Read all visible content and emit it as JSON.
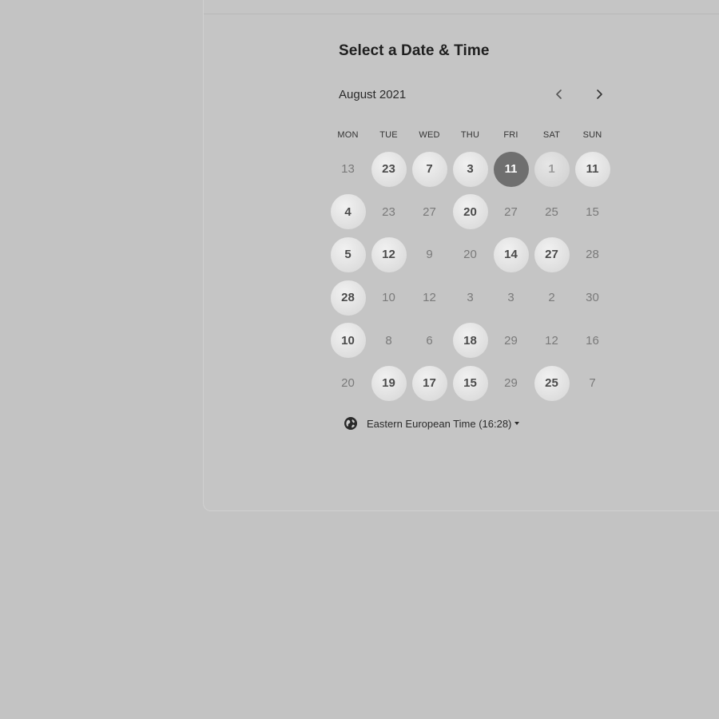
{
  "page": {
    "title": "Select a Date & Time"
  },
  "calendar": {
    "month_label": "August 2021",
    "prev_icon": "chevron-left-icon",
    "next_icon": "chevron-right-icon",
    "weekdays": [
      "MON",
      "TUE",
      "WED",
      "THU",
      "FRI",
      "SAT",
      "SUN"
    ],
    "weeks": [
      [
        {
          "label": "13",
          "state": "unavailable"
        },
        {
          "label": "23",
          "state": "available"
        },
        {
          "label": "7",
          "state": "available"
        },
        {
          "label": "3",
          "state": "available"
        },
        {
          "label": "11",
          "state": "selected"
        },
        {
          "label": "1",
          "state": "faded"
        },
        {
          "label": "11",
          "state": "available"
        }
      ],
      [
        {
          "label": "4",
          "state": "available"
        },
        {
          "label": "23",
          "state": "unavailable"
        },
        {
          "label": "27",
          "state": "unavailable"
        },
        {
          "label": "20",
          "state": "available"
        },
        {
          "label": "27",
          "state": "unavailable"
        },
        {
          "label": "25",
          "state": "unavailable"
        },
        {
          "label": "15",
          "state": "unavailable"
        }
      ],
      [
        {
          "label": "5",
          "state": "available"
        },
        {
          "label": "12",
          "state": "available"
        },
        {
          "label": "9",
          "state": "unavailable"
        },
        {
          "label": "20",
          "state": "unavailable"
        },
        {
          "label": "14",
          "state": "available"
        },
        {
          "label": "27",
          "state": "available"
        },
        {
          "label": "28",
          "state": "unavailable"
        }
      ],
      [
        {
          "label": "28",
          "state": "available"
        },
        {
          "label": "10",
          "state": "unavailable"
        },
        {
          "label": "12",
          "state": "unavailable"
        },
        {
          "label": "3",
          "state": "unavailable"
        },
        {
          "label": "3",
          "state": "unavailable"
        },
        {
          "label": "2",
          "state": "unavailable"
        },
        {
          "label": "30",
          "state": "unavailable"
        }
      ],
      [
        {
          "label": "10",
          "state": "available"
        },
        {
          "label": "8",
          "state": "unavailable"
        },
        {
          "label": "6",
          "state": "unavailable"
        },
        {
          "label": "18",
          "state": "available"
        },
        {
          "label": "29",
          "state": "unavailable"
        },
        {
          "label": "12",
          "state": "unavailable"
        },
        {
          "label": "16",
          "state": "unavailable"
        }
      ],
      [
        {
          "label": "20",
          "state": "unavailable"
        },
        {
          "label": "19",
          "state": "available"
        },
        {
          "label": "17",
          "state": "available"
        },
        {
          "label": "15",
          "state": "available"
        },
        {
          "label": "29",
          "state": "unavailable"
        },
        {
          "label": "25",
          "state": "available"
        },
        {
          "label": "7",
          "state": "unavailable"
        }
      ]
    ]
  },
  "timezone": {
    "icon": "globe-icon",
    "label": "Eastern European Time (16:28)",
    "caret_icon": "caret-down-icon"
  },
  "colors": {
    "background": "#c3c3c3",
    "selected_day": "#6f6f6f",
    "available_day": "#e2e2e2"
  }
}
